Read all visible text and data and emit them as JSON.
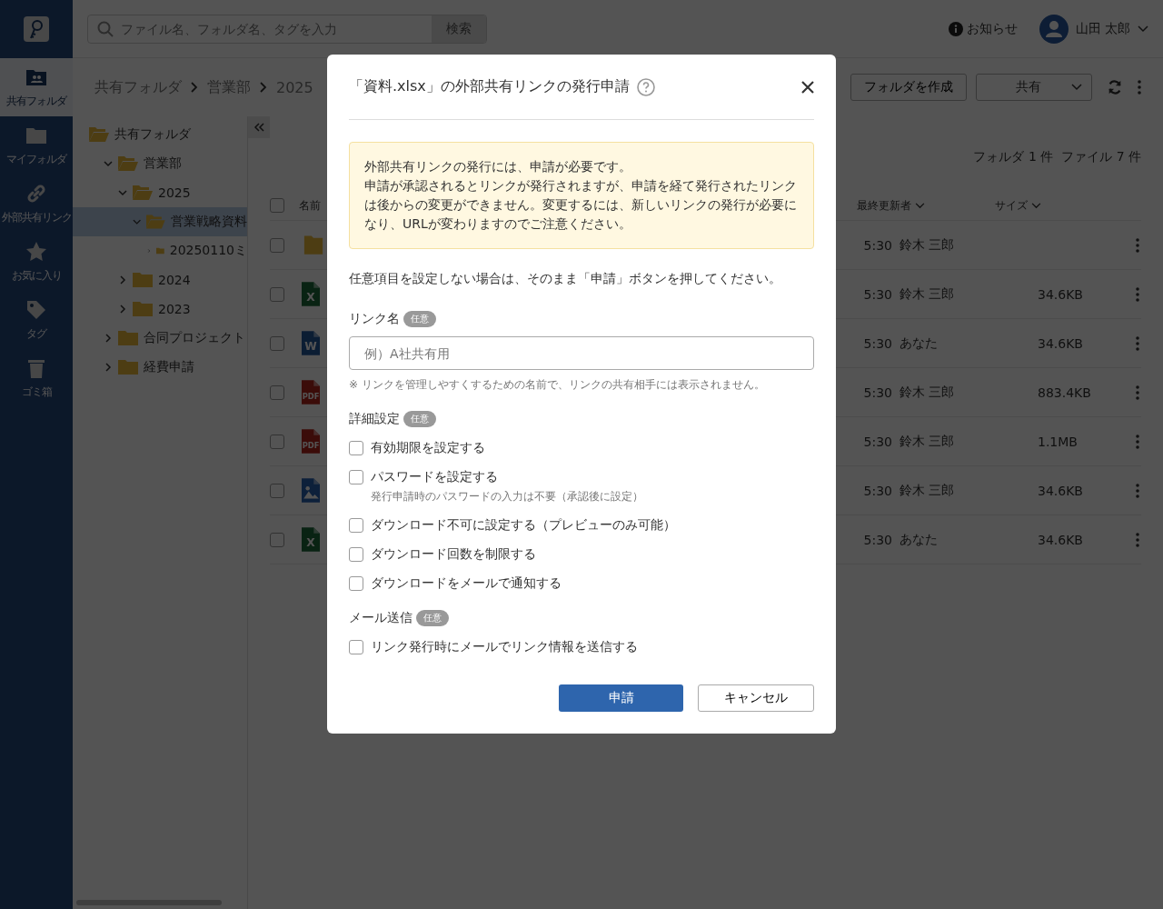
{
  "nav": [
    {
      "label": "共有フォルダ",
      "selected": true
    },
    {
      "label": "マイフォルダ",
      "selected": false
    },
    {
      "label": "外部共有リンク",
      "selected": false
    },
    {
      "label": "お気に入り",
      "selected": false
    },
    {
      "label": "タグ",
      "selected": false
    },
    {
      "label": "ゴミ箱",
      "selected": false
    }
  ],
  "search": {
    "placeholder": "ファイル名、フォルダ名、タグを入力",
    "button": "検索"
  },
  "header": {
    "notice": "お知らせ",
    "user": "山田 太郎"
  },
  "breadcrumb": [
    "共有フォルダ",
    "営業部",
    "2025"
  ],
  "toolbar": {
    "create_folder": "フォルダを作成",
    "share_select": "共有"
  },
  "tree": [
    {
      "label": "共有フォルダ",
      "expanded": true,
      "selected": false,
      "children": [
        {
          "label": "営業部",
          "expanded": true,
          "selected": false,
          "children": [
            {
              "label": "2025",
              "expanded": true,
              "selected": false,
              "children": [
                {
                  "label": "営業戦略資料",
                  "expanded": true,
                  "selected": true,
                  "children": [
                    {
                      "label": "20250110ミ",
                      "expanded": false,
                      "selected": false
                    }
                  ]
                }
              ]
            },
            {
              "label": "2024",
              "expanded": false,
              "selected": false
            },
            {
              "label": "2023",
              "expanded": false,
              "selected": false
            }
          ]
        },
        {
          "label": "合同プロジェクト",
          "expanded": false,
          "selected": false
        },
        {
          "label": "経費申請",
          "expanded": false,
          "selected": false
        }
      ]
    }
  ],
  "counts": "フォルダ 1 件  ファイル 7 件",
  "table": {
    "columns": [
      "名前",
      "最終更新者",
      "サイズ"
    ],
    "select_all_checked": false,
    "rows": [
      {
        "kind": "folder",
        "icon_text": "",
        "time": "5:30",
        "updater": "鈴木 三郎",
        "size": "",
        "checked": false
      },
      {
        "kind": "excel",
        "icon_text": "X",
        "time": "5:30",
        "updater": "鈴木 三郎",
        "size": "34.6KB",
        "checked": false
      },
      {
        "kind": "word",
        "icon_text": "W",
        "time": "5:30",
        "updater": "あなた",
        "size": "34.6KB",
        "checked": false
      },
      {
        "kind": "pdf",
        "icon_text": "PDF",
        "time": "5:30",
        "updater": "鈴木 三郎",
        "size": "883.4KB",
        "checked": false
      },
      {
        "kind": "pdf",
        "icon_text": "PDF",
        "time": "5:30",
        "updater": "鈴木 三郎",
        "size": "1.1MB",
        "checked": false
      },
      {
        "kind": "image",
        "icon_text": "",
        "time": "5:30",
        "updater": "鈴木 三郎",
        "size": "34.6KB",
        "checked": false
      },
      {
        "kind": "excel",
        "icon_text": "X",
        "time": "5:30",
        "updater": "あなた",
        "size": "34.6KB",
        "checked": false
      }
    ]
  },
  "modal": {
    "title": "「資料.xlsx」の外部共有リンクの発行申請",
    "notice": [
      "外部共有リンクの発行には、申請が必要です。",
      "申請が承認されるとリンクが発行されますが、申請を経て発行されたリンクは後からの変更ができません。変更するには、新しいリンクの発行が必要になり、URLが変わりますのでご注意ください。"
    ],
    "instruction": "任意項目を設定しない場合は、そのまま「申請」ボタンを押してください。",
    "link_name": {
      "label": "リンク名",
      "badge": "任意",
      "placeholder": "例）A社共有用",
      "hint": "※ リンクを管理しやすくするための名前で、リンクの共有相手には表示されません。"
    },
    "sections": [
      {
        "label": "詳細設定",
        "badge": "任意",
        "options": [
          {
            "label": "有効期限を設定する",
            "checked": false
          },
          {
            "label": "パスワードを設定する",
            "checked": false,
            "hint": "発行申請時のパスワードの入力は不要（承認後に設定）"
          },
          {
            "label": "ダウンロード不可に設定する（プレビューのみ可能）",
            "checked": false
          },
          {
            "label": "ダウンロード回数を制限する",
            "checked": false
          },
          {
            "label": "ダウンロードをメールで通知する",
            "checked": false
          }
        ]
      },
      {
        "label": "メール送信",
        "badge": "任意",
        "options": [
          {
            "label": "リンク発行時にメールでリンク情報を送信する",
            "checked": false
          }
        ]
      }
    ],
    "submit": "申請",
    "cancel": "キャンセル"
  }
}
